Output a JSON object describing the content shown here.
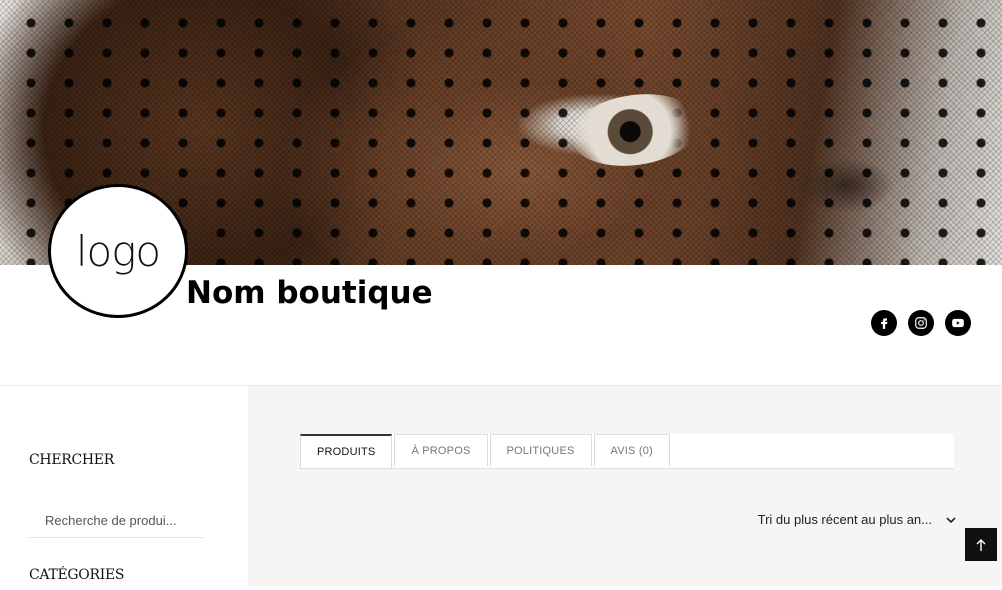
{
  "header": {
    "banner_alt": "portrait banner",
    "logo_text": "logo",
    "shop_name": "Nom boutique",
    "socials": [
      "facebook-icon",
      "instagram-icon",
      "youtube-icon"
    ]
  },
  "sidebar": {
    "search_heading": "CHERCHER",
    "search_placeholder": "Recherche de produi...",
    "categories_heading": "CATÉGORIES"
  },
  "tabs": [
    "PRODUITS",
    "À PROPOS",
    "POLITIQUES",
    "AVIS (0)"
  ],
  "active_tab": "PRODUITS",
  "sort": {
    "label": "Tri du plus récent au plus an..."
  },
  "colors": {
    "accent": "#000000",
    "main_bg": "#f6f5f3",
    "tab_border": "#d8dde3"
  }
}
